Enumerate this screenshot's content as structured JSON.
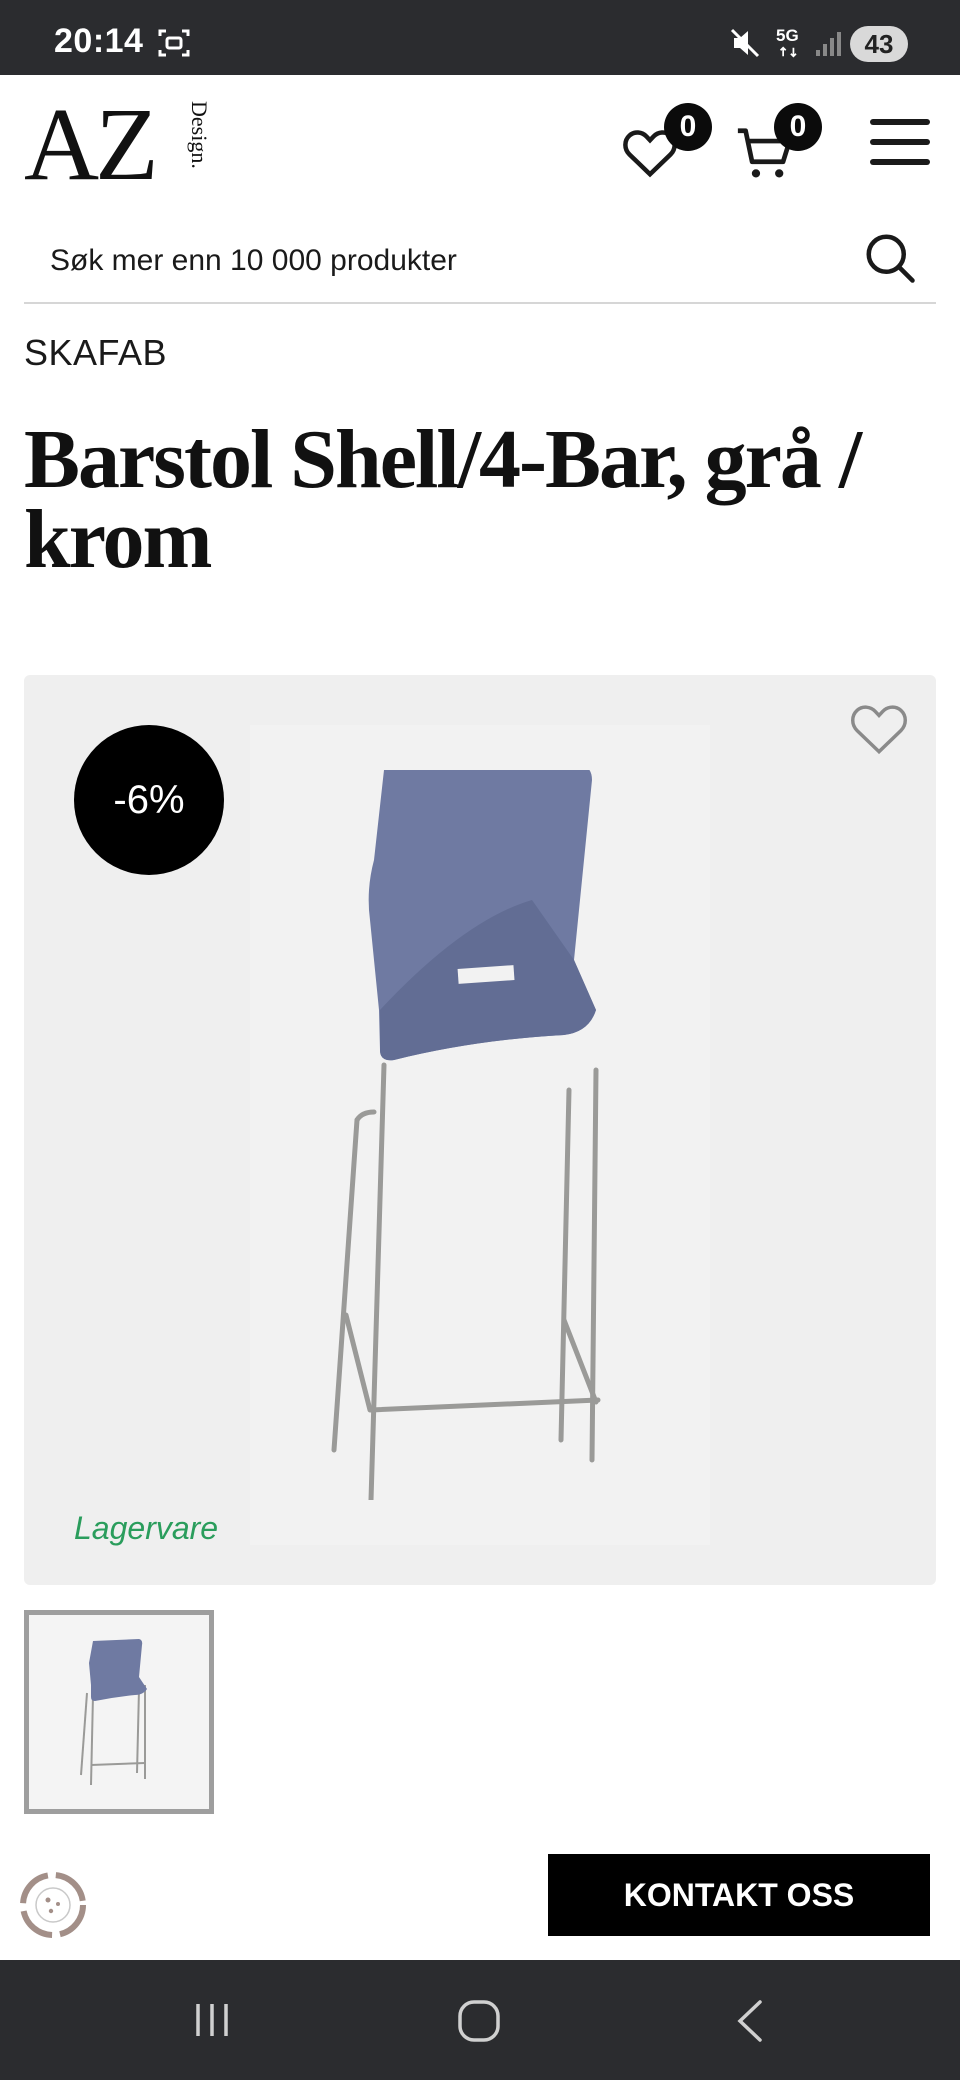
{
  "status_bar": {
    "time": "20:14",
    "network": "5G",
    "battery": "43",
    "icons": [
      "screen-record-icon",
      "mute-icon",
      "5g-icon",
      "signal-icon",
      "battery-icon"
    ]
  },
  "header": {
    "logo_main": "AZ",
    "logo_sub": "Design.",
    "wishlist_count": "0",
    "cart_count": "0"
  },
  "search": {
    "placeholder": "Søk mer enn 10 000 produkter"
  },
  "product": {
    "brand": "SKAFAB",
    "title": "Barstol Shell/4-Bar, grå / krom",
    "discount": "-6%",
    "stock_status": "Lagervare",
    "stock_color": "#2a9d5c"
  },
  "actions": {
    "contact_label": "KONTAKT OSS"
  },
  "colors": {
    "status_bar_bg": "#2b2c2f",
    "badge_bg": "#0b0b0b",
    "gallery_bg": "#efefef",
    "chair_shell": "#6f7aa2",
    "chair_frame": "#9a9a98"
  }
}
